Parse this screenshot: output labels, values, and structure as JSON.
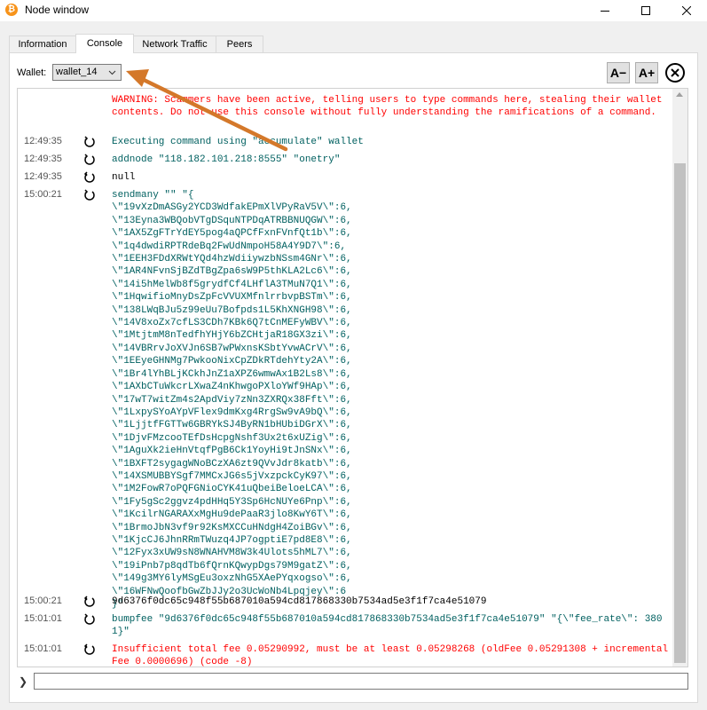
{
  "window": {
    "title": "Node window",
    "app_icon_glyph": "₿",
    "controls": [
      "minimize-icon",
      "maximize-icon",
      "close-icon"
    ]
  },
  "tabs": [
    {
      "label": "Information"
    },
    {
      "label": "Console"
    },
    {
      "label": "Network Traffic"
    },
    {
      "label": "Peers"
    }
  ],
  "active_tab": "Console",
  "wallet": {
    "label": "Wallet:",
    "selected": "wallet_14"
  },
  "font_buttons": {
    "decrease": "A−",
    "increase": "A+"
  },
  "colors": {
    "warning": "#ff0000",
    "command": "#006060",
    "reply": "#000000",
    "error": "#ff0000",
    "annotation_arrow": "#d4782a"
  },
  "console": {
    "warning": "WARNING: Scammers have been active, telling users to type commands here, stealing their wallet contents. Do not use this console without fully understanding the ramifications of a command.",
    "entries": [
      {
        "time": "12:49:35",
        "kind": "cmd",
        "text": "Executing command using \"accumulate\" wallet"
      },
      {
        "time": "12:49:35",
        "kind": "cmd",
        "text": "addnode \"118.182.101.218:8555\" \"onetry\""
      },
      {
        "time": "12:49:35",
        "kind": "reply",
        "text": "null"
      },
      {
        "time": "15:00:21",
        "kind": "cmd",
        "text": "sendmany \"\" \"{\n\\\"19vXzDmASGy2YCD3WdfakEPmXlVPyRaV5V\\\":6,\n\\\"13Eyna3WBQobVTgDSquNTPDqATRBBNUQGW\\\":6,\n\\\"1AX5ZgFTrYdEY5pog4aQPCfFxnFVnfQt1b\\\":6,\n\\\"1q4dwdiRPTRdeBq2FwUdNmpoH58A4Y9D7\\\":6,\n\\\"1EEH3FDdXRWtYQd4hzWdiiywzbNSsm4GNr\\\":6,\n\\\"1AR4NFvnSjBZdTBgZpa6sW9P5thKLA2Lc6\\\":6,\n\\\"14i5hMelWb8f5grydfCf4LHflA3TMuN7Q1\\\":6,\n\\\"1HqwifioMnyDsZpFcVVUXMfnlrrbvpBSTm\\\":6,\n\\\"138LWqBJu5z99eUu7Bofpds1L5KhXNGH98\\\":6,\n\\\"14V8xoZx7cfLS3CDh7KBk6Q7tCnMEFyWBV\\\":6,\n\\\"1MtjtmM8nTedfhYHjY6bZCHtjaR18GX3zi\\\":6,\n\\\"14VBRrvJoXVJn6SB7wPWxnsKSbtYvwACrV\\\":6,\n\\\"1EEyeGHNMg7PwkooNixCpZDkRTdehYty2A\\\":6,\n\\\"1Br4lYhBLjKCkhJnZ1aXPZ6wmwAx1B2Ls8\\\":6,\n\\\"1AXbCTuWkcrLXwaZ4nKhwgoPXloYWf9HAp\\\":6,\n\\\"17wT7witZm4s2ApdViy7zNn3ZXRQx38Fft\\\":6,\n\\\"1LxpySYoAYpVFlex9dmKxg4RrgSw9vA9bQ\\\":6,\n\\\"1LjjtfFGTTw6GBRYkSJ4ByRN1bHUbiDGrX\\\":6,\n\\\"1DjvFMzcooTEfDsHcpgNshf3Ux2t6xUZig\\\":6,\n\\\"1AguXk2ieHnVtqfPgB6Ck1YoyHi9tJnSNx\\\":6,\n\\\"1BXFT2sygagWNoBCzXA6zt9QVvJdr8katb\\\":6,\n\\\"14XSMUBBYSgf7MMCxJG6s5jVxzpckCyK97\\\":6,\n\\\"1M2FowR7oPQFGNioCYK41uQbeiBeloeLCA\\\":6,\n\\\"1Fy5gSc2ggvz4pdHHq5Y3Sp6HcNUYe6Pnp\\\":6,\n\\\"1KcilrNGARAXxMgHu9dePaaR3jlo8KwY6T\\\":6,\n\\\"1BrmoJbN3vf9r92KsMXCCuHNdgH4ZoiBGv\\\":6,\n\\\"1KjcCJ6JhnRRmTWuzq4JP7ogptiE7pd8E8\\\":6,\n\\\"12Fyx3xUW9sN8WNAHVM8W3k4Ulots5hML7\\\":6,\n\\\"19iPnb7p8qdTb6fQrnKQwypDgs79M9gatZ\\\":6,\n\\\"149g3MY6lyMSgEu3oxzNhG5XAePYqxogso\\\":6,\n\\\"16WFNwQoofbGwZbJJy2o3UcWoNb4Lpqjey\\\":6\n}\""
      },
      {
        "time": "15:00:21",
        "kind": "reply",
        "text": "9d6376f0dc65c948f55b687010a594cd817868330b7534ad5e3f1f7ca4e51079"
      },
      {
        "time": "15:01:01",
        "kind": "cmd",
        "text": "bumpfee \"9d6376f0dc65c948f55b687010a594cd817868330b7534ad5e3f1f7ca4e51079\" \"{\\\"fee_rate\\\": 3801}\""
      },
      {
        "time": "15:01:01",
        "kind": "err",
        "text": "Insufficient total fee 0.05290992, must be at least 0.05298268 (oldFee 0.05291308 + incrementalFee 0.0000696) (code -8)"
      }
    ]
  },
  "prompt": {
    "glyph": "❯",
    "value": ""
  }
}
